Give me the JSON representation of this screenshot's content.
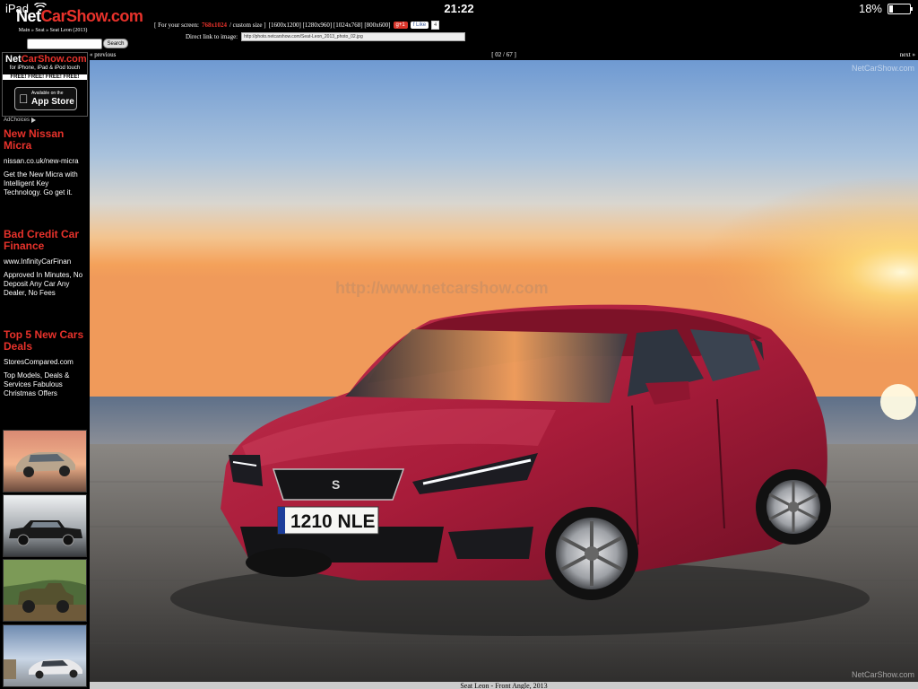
{
  "status_bar": {
    "device": "iPad",
    "time": "21:22",
    "battery": "18%",
    "battery_level": 0.18
  },
  "site": {
    "logo_part1": "Net",
    "logo_part2": "CarShow.com",
    "breadcrumb": "Main » Seat » Seat Leon (2013)",
    "search_placeholder": "",
    "search_button": "Search"
  },
  "sizes": {
    "prefix": "[ For your screen:",
    "current": "768x1024",
    "custom": "/ custom size ]",
    "options": "[1600x1200] [1280x960] [1024x768] [800x600]",
    "gplus": "g+1",
    "fb_like": "f Like",
    "like_count": "4"
  },
  "direct_link": {
    "label": "Direct link to image:",
    "value": "http://photo.netcarshow.com/Seat-Leon_2013_photo_02.jpg"
  },
  "nav": {
    "prev": "« previous",
    "counter": "[ 02 / 67 ]",
    "next": "next »"
  },
  "promo": {
    "title_part1": "Net",
    "title_part2": "CarShow.com",
    "subtitle": "for iPhone, iPad & iPod touch",
    "free": "FREE! FREE! FREE! FREE!",
    "appstore_small": "Available on the",
    "appstore_big": "App Store"
  },
  "adchoices": "AdChoices",
  "ads": [
    {
      "headline": "New Nissan Micra",
      "url": "nissan.co.uk/new-micra",
      "desc": "Get the New Micra with Intelligent Key Technology. Go get it."
    },
    {
      "headline": "Bad Credit Car Finance",
      "url": "www.InfinityCarFinan",
      "desc": "Approved In Minutes, No Deposit Any Car Any Dealer, No Fees"
    },
    {
      "headline": "Top 5 New Cars Deals",
      "url": "StoresCompared.com",
      "desc": "Top Models, Deals & Services Fabulous Christmas Offers"
    }
  ],
  "photo": {
    "watermark": "NetCarShow.com",
    "center_watermark": "http://www.netcarshow.com",
    "plate": "1210 NLE"
  },
  "caption": "Seat Leon - Front Angle, 2013"
}
